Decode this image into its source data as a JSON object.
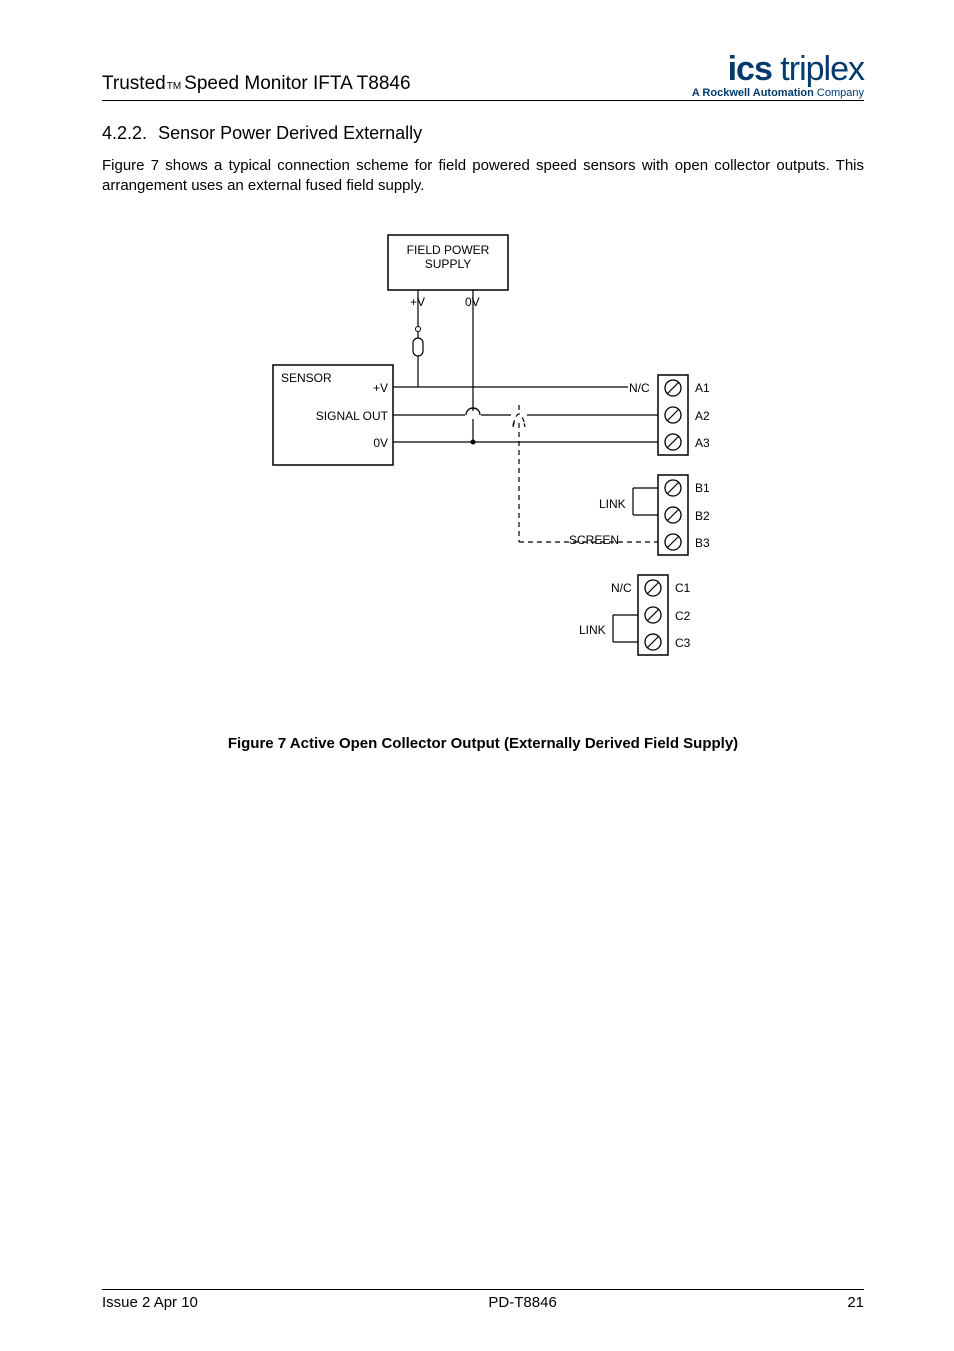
{
  "header": {
    "product_prefix": "Trusted",
    "tm": "TM",
    "product_rest": "Speed Monitor IFTA T8846",
    "logo_brand_bold": "ics",
    "logo_brand_rest": " triplex",
    "logo_tag_prefix": "A ",
    "logo_tag_bold": "Rockwell Automation",
    "logo_tag_suffix": " Company"
  },
  "section": {
    "num": "4.2.2.",
    "title": "Sensor Power Derived Externally"
  },
  "body_text": "Figure 7 shows a typical connection scheme for field powered speed sensors with open collector outputs. This arrangement uses an external fused field supply.",
  "diagram": {
    "field_power": "FIELD POWER",
    "supply": "SUPPLY",
    "plus_v": "+V",
    "zero_v": "0V",
    "sensor": "SENSOR",
    "signal_out": "SIGNAL OUT",
    "nc": "N/C",
    "link": "LINK",
    "screen": "SCREEN",
    "terminals": {
      "a1": "A1",
      "a2": "A2",
      "a3": "A3",
      "b1": "B1",
      "b2": "B2",
      "b3": "B3",
      "c1": "C1",
      "c2": "C2",
      "c3": "C3"
    }
  },
  "figure_caption": "Figure 7 Active Open Collector Output (Externally Derived Field Supply)",
  "footer": {
    "left": "Issue 2 Apr 10",
    "center": "PD-T8846",
    "right": "21"
  }
}
